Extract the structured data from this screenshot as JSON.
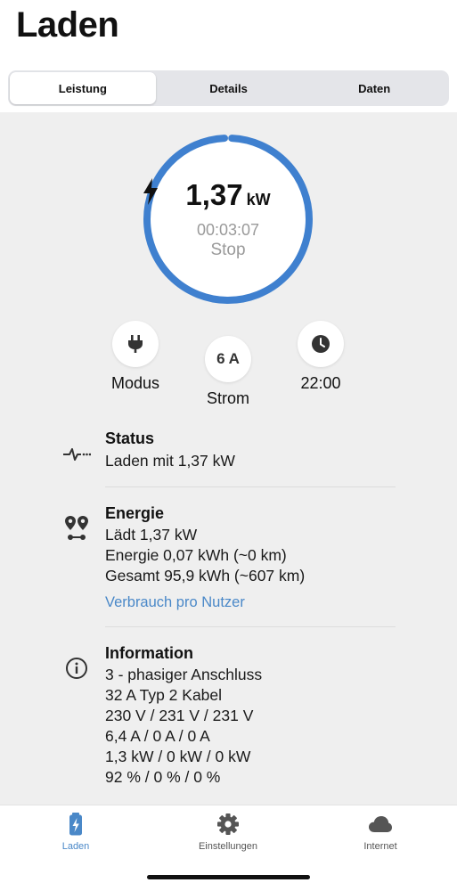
{
  "header": {
    "title": "Laden"
  },
  "tabs": [
    {
      "label": "Leistung",
      "active": true
    },
    {
      "label": "Details",
      "active": false
    },
    {
      "label": "Daten",
      "active": false
    }
  ],
  "charging": {
    "power_value": "1,37",
    "power_unit": "kW",
    "elapsed": "00:03:07",
    "action_label": "Stop",
    "progress_fraction": 0.985,
    "ring_color": "#3f80cf"
  },
  "controls": {
    "mode_label": "Modus",
    "current_value": "6 A",
    "current_label": "Strom",
    "timer_label": "22:00"
  },
  "status": {
    "title": "Status",
    "lines": [
      "Laden mit 1,37 kW"
    ]
  },
  "energy": {
    "title": "Energie",
    "lines": [
      "Lädt 1,37 kW",
      "Energie 0,07 kWh (~0 km)",
      "Gesamt 95,9 kWh (~607 km)"
    ],
    "link": "Verbrauch pro Nutzer"
  },
  "information": {
    "title": "Information",
    "lines": [
      "3 - phasiger Anschluss",
      "32 A Typ 2 Kabel",
      "230 V / 231 V / 231 V",
      "6,4 A / 0 A / 0 A",
      "1,3 kW / 0 kW / 0 kW",
      "92 % / 0 % / 0 %"
    ]
  },
  "tabbar": {
    "items": [
      {
        "label": "Laden",
        "icon": "battery-charging-icon",
        "active": true
      },
      {
        "label": "Einstellungen",
        "icon": "gear-icon",
        "active": false
      },
      {
        "label": "Internet",
        "icon": "cloud-icon",
        "active": false
      }
    ]
  },
  "colors": {
    "accent": "#4a88c8",
    "ring": "#3f80cf",
    "background": "#efefef"
  }
}
